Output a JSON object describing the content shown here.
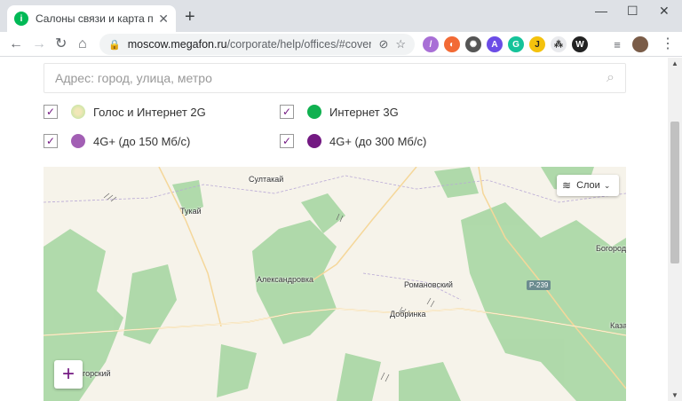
{
  "browser": {
    "tab_title": "Салоны связи и карта покрытия",
    "url_domain": "moscow.megafon.ru",
    "url_path": "/corporate/help/offices/#cover..."
  },
  "page": {
    "search_placeholder": "Адрес: город, улица, метро",
    "legend": [
      {
        "label": "Голос и Интернет 2G",
        "color": "#d8e8b0"
      },
      {
        "label": "Интернет 3G",
        "color": "#10b150"
      },
      {
        "label": "4G+ (до 150 Мб/с)",
        "color": "#a25fb4"
      },
      {
        "label": "4G+ (до 300 Мб/с)",
        "color": "#731982"
      }
    ]
  },
  "map": {
    "layers_label": "Слои",
    "zoom_in": "+",
    "road_badge": "Р-239",
    "places": [
      {
        "name": "Султакай"
      },
      {
        "name": "Тукай"
      },
      {
        "name": "Александровка"
      },
      {
        "name": "Романовский"
      },
      {
        "name": "Добринка"
      },
      {
        "name": "Богород"
      },
      {
        "name": "Каза"
      },
      {
        "name": "горский"
      }
    ]
  }
}
